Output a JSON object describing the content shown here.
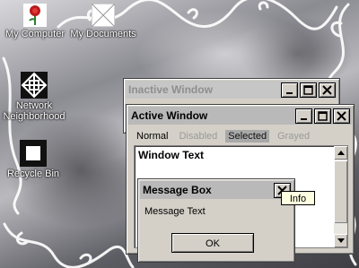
{
  "desktop": {
    "icons": [
      {
        "label": "My Computer",
        "icon": "my-computer-rose-icon"
      },
      {
        "label": "My Documents",
        "icon": "my-documents-icon"
      },
      {
        "label": "Network Neighborhood",
        "icon": "network-neighborhood-icon"
      },
      {
        "label": "Recycle Bin",
        "icon": "recycle-bin-icon"
      }
    ]
  },
  "inactive_window": {
    "title": "Inactive Window"
  },
  "active_window": {
    "title": "Active Window",
    "menu": {
      "normal": "Normal",
      "disabled": "Disabled",
      "selected": "Selected",
      "grayed": "Grayed"
    },
    "body_text": "Window Text"
  },
  "message_box": {
    "title": "Message Box",
    "text": "Message Text",
    "ok_label": "OK"
  },
  "tooltip": {
    "text": "Info"
  },
  "controls": {
    "minimize": "minimize-icon",
    "maximize": "maximize-icon",
    "close": "close-icon"
  },
  "colors": {
    "title_active": "#b9b9b9",
    "title_inactive": "#c6c6c6",
    "tooltip_bg": "#ffffe1"
  }
}
